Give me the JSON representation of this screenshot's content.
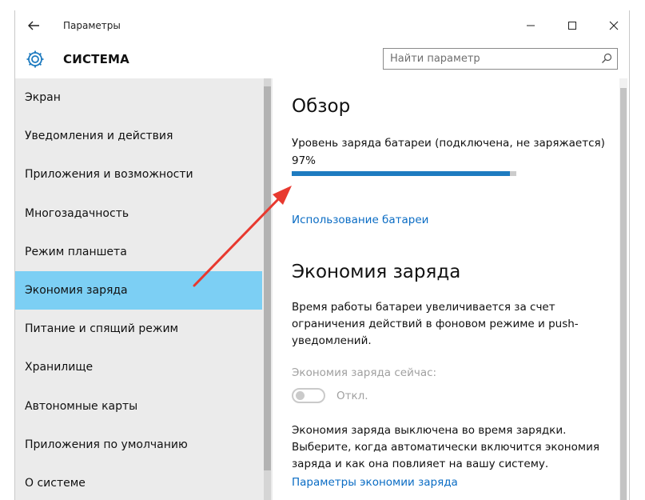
{
  "window": {
    "title": "Параметры"
  },
  "header": {
    "section_title": "СИСТЕМА"
  },
  "search": {
    "placeholder": "Найти параметр"
  },
  "sidebar": {
    "items": [
      {
        "label": "Экран"
      },
      {
        "label": "Уведомления и действия"
      },
      {
        "label": "Приложения и возможности"
      },
      {
        "label": "Многозадачность"
      },
      {
        "label": "Режим планшета"
      },
      {
        "label": "Экономия заряда",
        "selected": true
      },
      {
        "label": "Питание и спящий режим"
      },
      {
        "label": "Хранилище"
      },
      {
        "label": "Автономные карты"
      },
      {
        "label": "Приложения по умолчанию"
      },
      {
        "label": "О системе"
      }
    ]
  },
  "overview": {
    "heading": "Обзор",
    "battery_label": "Уровень заряда батареи (подключена, не заряжается)",
    "battery_percent_text": "97%",
    "battery_level": 0.97,
    "usage_link": "Использование батареи"
  },
  "saver": {
    "heading": "Экономия заряда",
    "description": "Время работы батареи увеличивается за счет ограничения действий в фоновом режиме и push-уведомлений.",
    "now_label": "Экономия заряда сейчас:",
    "toggle_state": "Откл.",
    "toggle_on": false,
    "info": "Экономия заряда выключена во время зарядки. Выберите, когда автоматически включится экономия заряда и как она повлияет на вашу систему.",
    "settings_link": "Параметры экономии заряда"
  },
  "colors": {
    "accent": "#1e7bc0",
    "selected_item": "#7ccff4",
    "link": "#0a6cc4",
    "annotation_arrow": "#e8392f"
  }
}
